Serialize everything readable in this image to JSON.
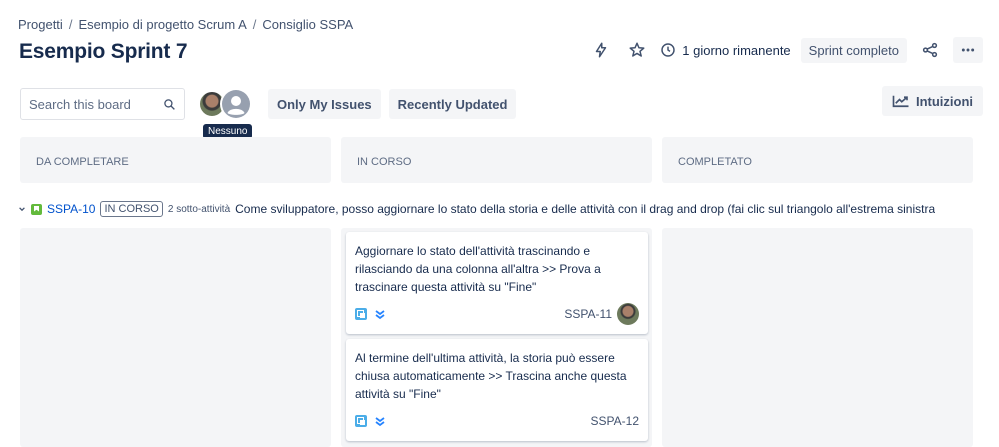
{
  "breadcrumb": {
    "items": [
      "Progetti",
      "Esempio di progetto Scrum A",
      "Consiglio SSPA"
    ],
    "separator": "/"
  },
  "header": {
    "title": "Esempio Sprint 7",
    "remaining": "1 giorno rimanente",
    "complete_sprint": "Sprint completo",
    "icons": [
      "lightning-icon",
      "star-icon",
      "clock-icon",
      "share-icon",
      "more-icon"
    ]
  },
  "toolbar": {
    "search_placeholder": "Search this board",
    "tooltip": "Nessuno",
    "filters": [
      "Only My Issues",
      "Recently Updated"
    ],
    "insights": "Intuizioni"
  },
  "columns": [
    {
      "name": "DA COMPLETARE"
    },
    {
      "name": "IN CORSO"
    },
    {
      "name": "COMPLETATO"
    }
  ],
  "swimlane": {
    "key": "SSPA-10",
    "status": "IN CORSO",
    "subtasks": "2 sotto-attività",
    "summary": "Come sviluppatore, posso aggiornare lo stato della storia e delle attività con il drag and drop (fai clic sul triangolo all'estrema sinistra"
  },
  "cards": [
    {
      "summary": "Aggiornare lo stato dell'attività trascinando e rilasciando da una colonna all'altra >> Prova a trascinare questa attività su \"Fine\"",
      "key": "SSPA-11",
      "has_avatar": true
    },
    {
      "summary": "Al termine dell'ultima attività, la storia può essere chiusa automaticamente >> Trascina anche questa attività su \"Fine\"",
      "key": "SSPA-12",
      "has_avatar": false
    }
  ],
  "colors": {
    "text": "#172b4d",
    "link": "#0052cc",
    "column_bg": "#f4f5f7",
    "story": "#63ba3c",
    "subtask": "#4bade8",
    "priority": "#2684ff"
  }
}
